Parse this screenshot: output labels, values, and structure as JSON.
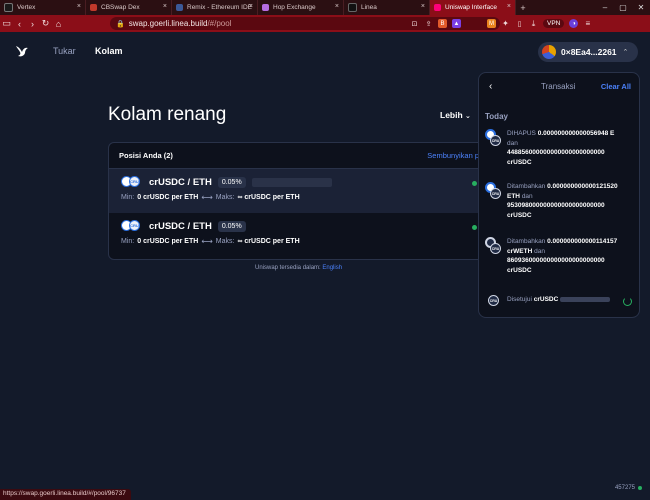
{
  "browser": {
    "tabs": [
      {
        "title": "Vertex",
        "color": "#1a1a1a",
        "active": false
      },
      {
        "title": "CBSwap Dex",
        "color": "#c0392b",
        "active": false
      },
      {
        "title": "Remix - Ethereum IDE",
        "color": "#3b5998",
        "active": false
      },
      {
        "title": "Hop Exchange",
        "color": "#b66ce0",
        "active": false
      },
      {
        "title": "Linea",
        "color": "#111111",
        "active": false
      },
      {
        "title": "Uniswap Interface",
        "color": "#ff007a",
        "active": true
      }
    ],
    "url_host": "swap.goerli.linea.build",
    "url_path": "/#/pool",
    "vpn_label": "VPN",
    "status_url": "https://swap.goerli.linea.build/#/pool/96737"
  },
  "app": {
    "nav": {
      "swap": "Tukar",
      "pool": "Kolam"
    },
    "wallet": {
      "address": "0×8Ea4...2261"
    },
    "page_title": "Kolam renang",
    "more_button": "Lebih",
    "positions": {
      "header": "Posisi Anda (2)",
      "hide_closed": "Sembunyikan p",
      "items": [
        {
          "pair": "crUSDC / ETH",
          "fee": "0.05%",
          "min_label": "Min:",
          "min_value": "0 crUSDC per ETH",
          "max_label": "Maks:",
          "max_value": "∞ crUSDC per ETH"
        },
        {
          "pair": "crUSDC / ETH",
          "fee": "0.05%",
          "min_label": "Min:",
          "min_value": "0 crUSDC per ETH",
          "max_label": "Maks:",
          "max_value": "∞ crUSDC per ETH"
        }
      ]
    },
    "footer": {
      "text": "Uniswap tersedia dalam:",
      "language": "English"
    },
    "block_number": "457275"
  },
  "transactions": {
    "title": "Transaksi",
    "clear_all": "Clear All",
    "section": "Today",
    "items": [
      {
        "badge": "CRU",
        "action": "DIHAPUS",
        "amount1": "0.000000000000056948 E",
        "connector": "dan",
        "amount2": "448856000000000000000000000",
        "token2": "crUSDC"
      },
      {
        "badge": "CRU",
        "action": "Ditambahkan",
        "amount1": "0.000000000000121520",
        "token1": "ETH",
        "connector": "dan",
        "amount2": "953098000000000000000000000",
        "token2": "crUSDC"
      },
      {
        "badge": "CRU",
        "action": "Ditambahkan",
        "amount1": "0.000000000000114157",
        "token1": "crWETH",
        "connector": "dan",
        "amount2": "860936000000000000000000000",
        "token2": "crUSDC"
      },
      {
        "badge": "CRU",
        "action": "Disetujui",
        "amount1": "crUSDC"
      }
    ]
  }
}
